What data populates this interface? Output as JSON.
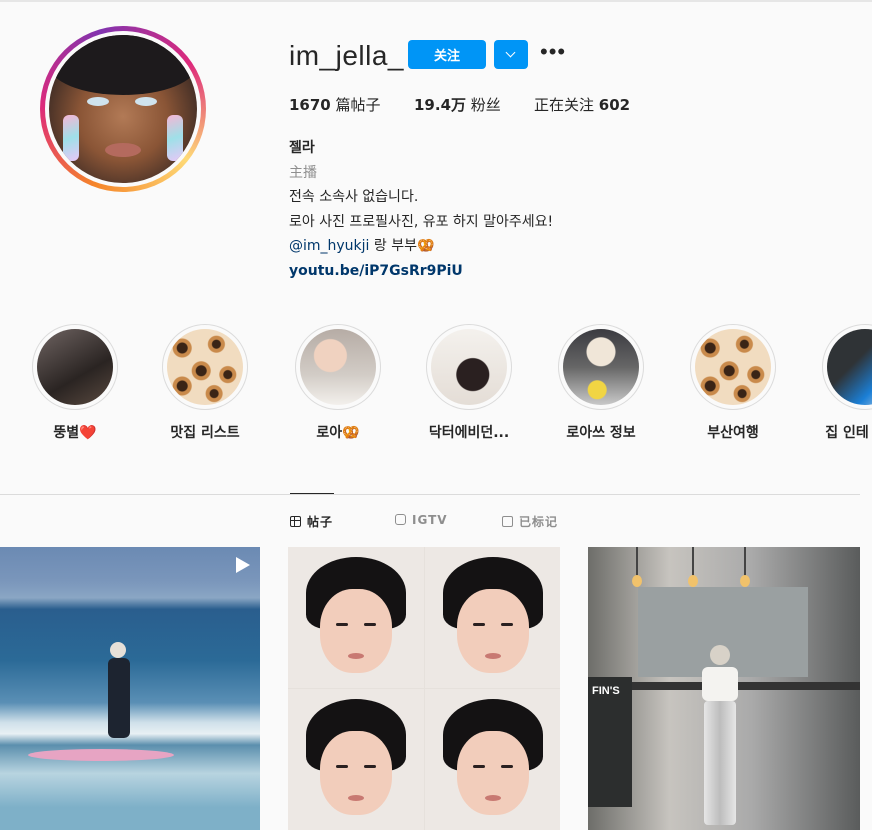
{
  "profile": {
    "username": "im_jella_",
    "follow_label": "关注",
    "more_label": "•••",
    "stats": {
      "posts_count": "1670",
      "posts_label": " 篇帖子",
      "followers_count": "19.4万",
      "followers_label": " 粉丝",
      "following_label": "正在关注 ",
      "following_count": "602"
    },
    "bio": {
      "name": "젤라",
      "category": "主播",
      "line1": "전속 소속사 없습니다.",
      "line2": "로아 사진 프로필사진, 유포 하지 말아주세요!",
      "mention": "@im_hyukji",
      "mention_suffix": " 랑 부부🥨",
      "link": "youtu.be/iP7GsRr9PiU"
    }
  },
  "highlights": [
    {
      "label": "뚱별❤️"
    },
    {
      "label": "맛집 리스트"
    },
    {
      "label": "로아🥨"
    },
    {
      "label": "닥터에비던..."
    },
    {
      "label": "로아쓰 정보"
    },
    {
      "label": "부산여행"
    },
    {
      "label": "집 인테"
    }
  ],
  "tabs": [
    {
      "label": "帖子",
      "icon": "grid-icon",
      "active": true
    },
    {
      "label": "IGTV",
      "icon": "igtv-icon",
      "active": false
    },
    {
      "label": "已标记",
      "icon": "tagged-icon",
      "active": false
    }
  ],
  "posts": [
    {
      "type": "video",
      "icon": "play-icon"
    },
    {
      "type": "image"
    },
    {
      "type": "image",
      "sign_text": "FIN'S"
    }
  ],
  "colors": {
    "accent": "#0095f6",
    "link": "#00376b",
    "muted": "#8e8e8e",
    "text": "#262626",
    "background": "#fafafa"
  }
}
